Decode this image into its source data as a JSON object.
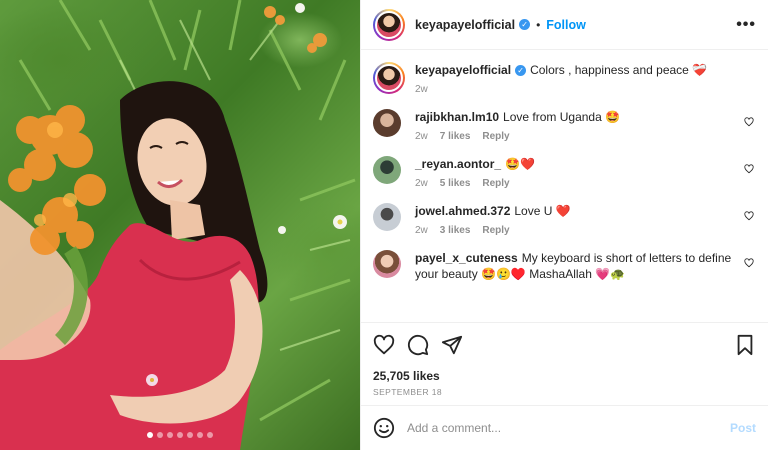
{
  "post": {
    "author": "keyapayelofficial",
    "follow_label": "Follow",
    "separator": "•",
    "more": "•••",
    "caption": "Colors , happiness and peace",
    "caption_emoji": "❤️‍🩹",
    "caption_time": "2w"
  },
  "comments": [
    {
      "user": "rajibkhan.lm10",
      "text": "Love from Uganda 🤩",
      "time": "2w",
      "likes": "7 likes",
      "reply": "Reply",
      "avatar_color": "#7a5a48"
    },
    {
      "user": "_reyan.aontor_",
      "text": "🤩❤️",
      "time": "2w",
      "likes": "5 likes",
      "reply": "Reply",
      "avatar_color": "#3f6a4a"
    },
    {
      "user": "jowel.ahmed.372",
      "text": "Love U ❤️",
      "time": "2w",
      "likes": "3 likes",
      "reply": "Reply",
      "avatar_color": "#8f9aa6"
    },
    {
      "user": "payel_x_cuteness",
      "text": "My keyboard is short of letters to define your beauty 🤩🥲♥️ MashaAllah 💗🐢",
      "avatar_color": "#c98a7a"
    }
  ],
  "stats": {
    "likes": "25,705 likes",
    "date": "SEPTEMBER 18"
  },
  "composer": {
    "placeholder": "Add a comment...",
    "post_label": "Post"
  },
  "icons": {
    "like": "heart-icon",
    "comment": "comment-icon",
    "share": "share-icon",
    "save": "bookmark-icon",
    "emoji": "emoji-icon"
  },
  "colors": {
    "follow": "#0095f6",
    "verified": "#3897f0",
    "post_disabled": "#b3dbff"
  }
}
